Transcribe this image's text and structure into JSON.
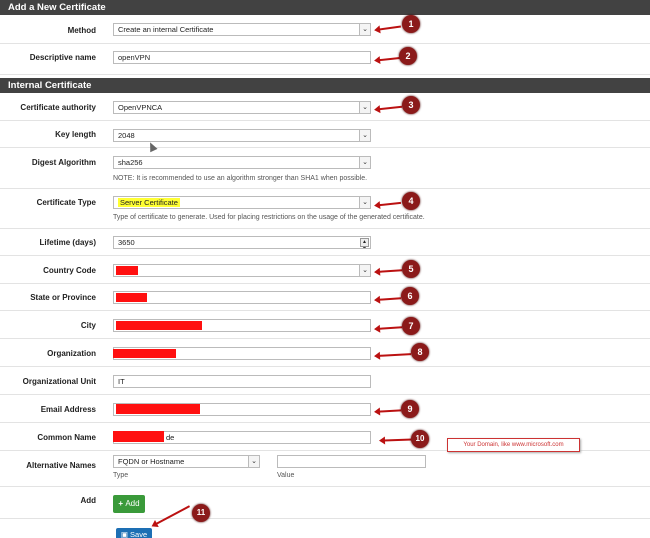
{
  "sections": {
    "add_new": "Add a New Certificate",
    "internal": "Internal Certificate"
  },
  "method": {
    "label": "Method",
    "value": "Create an internal Certificate"
  },
  "descriptive_name": {
    "label": "Descriptive name",
    "value": "openVPN"
  },
  "certificate_authority": {
    "label": "Certificate authority",
    "value": "OpenVPNCA"
  },
  "key_length": {
    "label": "Key length",
    "value": "2048"
  },
  "digest_algorithm": {
    "label": "Digest Algorithm",
    "value": "sha256",
    "note": "NOTE: It is recommended to use an algorithm stronger than SHA1 when possible."
  },
  "certificate_type": {
    "label": "Certificate Type",
    "value": "Server Certificate",
    "note": "Type of certificate to generate. Used for placing restrictions on the usage of the generated certificate."
  },
  "lifetime": {
    "label": "Lifetime (days)",
    "value": "3650"
  },
  "country_code": {
    "label": "Country Code"
  },
  "state": {
    "label": "State or Province"
  },
  "city": {
    "label": "City"
  },
  "organization": {
    "label": "Organization"
  },
  "org_unit": {
    "label": "Organizational Unit",
    "value": "IT"
  },
  "email": {
    "label": "Email Address"
  },
  "common_name": {
    "label": "Common Name",
    "value_suffix": "de"
  },
  "alt_names": {
    "label": "Alternative Names",
    "type_value": "FQDN or Hostname",
    "type_label": "Type",
    "value_label": "Value"
  },
  "add": {
    "label": "Add",
    "button": "Add"
  },
  "save": {
    "button": "Save"
  },
  "domain_note": "Your Domain, like www.microsoft.com",
  "badges": [
    "1",
    "2",
    "3",
    "4",
    "5",
    "6",
    "7",
    "8",
    "9",
    "10",
    "11"
  ],
  "colors": {
    "header": "#424242",
    "redaction": "#ff1010",
    "badge": "#8b1a1a",
    "add_button": "#3a9a3a",
    "save_button": "#1d6fb4"
  }
}
